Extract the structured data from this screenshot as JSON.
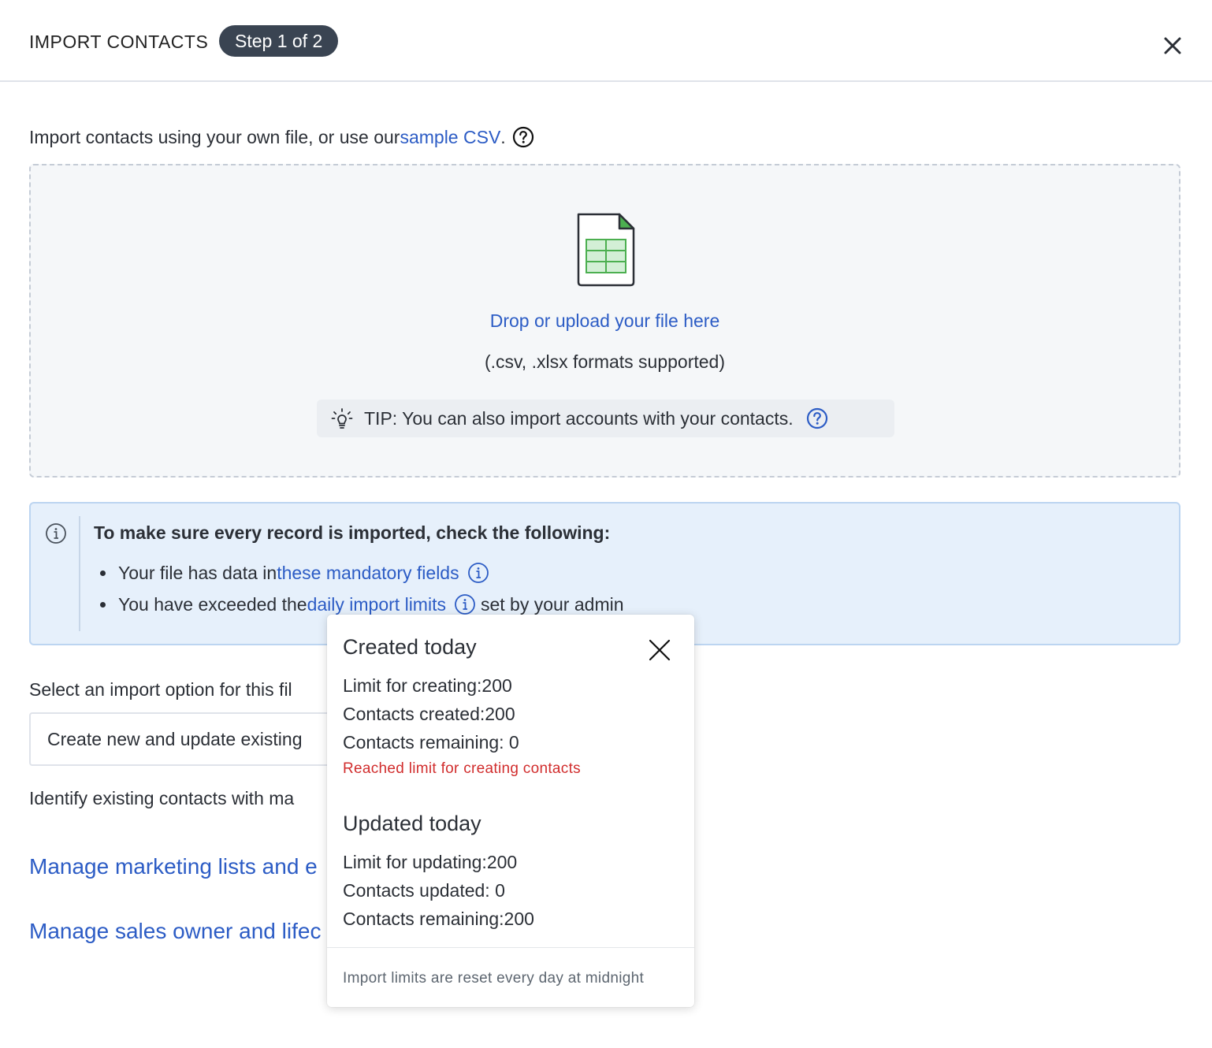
{
  "header": {
    "title": "IMPORT CONTACTS",
    "step": "Step 1 of 2"
  },
  "intro": {
    "text": "Import contacts using your own file, or use our ",
    "link": "sample CSV",
    "suffix": "."
  },
  "dropzone": {
    "label": "Drop or upload your file here",
    "formats": "(.csv, .xlsx formats supported)",
    "tip": "TIP: You can also import accounts with your contacts."
  },
  "info": {
    "heading": "To make sure every record is imported, check the following:",
    "item1_prefix": "Your file has data in ",
    "item1_link": "these mandatory fields",
    "item2_prefix": "You have exceeded the ",
    "item2_link": "daily import limits",
    "item2_suffix": "set by your admin"
  },
  "options": {
    "select_label": "Select an import option for this fil",
    "select_value": "Create new and update existing",
    "identify_label": "Identify existing contacts with ma",
    "manage_lists": "Manage marketing lists and e",
    "manage_owner": "Manage sales owner and lifec"
  },
  "popover": {
    "created_heading": "Created today",
    "limit_creating": "Limit for creating:200",
    "contacts_created": "Contacts created:200",
    "created_remaining": "Contacts remaining: 0",
    "warning": "Reached limit for creating contacts",
    "updated_heading": "Updated today",
    "limit_updating": "Limit for updating:200",
    "contacts_updated": "Contacts updated: 0",
    "updated_remaining": "Contacts remaining:200",
    "footer": "Import limits are reset every day at midnight"
  },
  "colors": {
    "link": "#2c5cc5",
    "warning": "#d12d2d",
    "badge": "#3a4452",
    "info_bg": "#e6f0fb"
  }
}
